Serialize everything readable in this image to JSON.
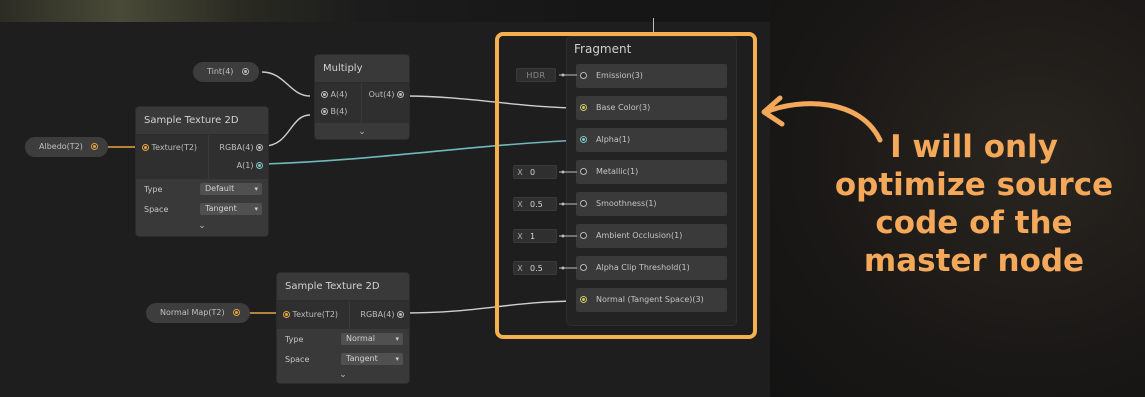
{
  "nodes": {
    "tint": {
      "label": "Tint(4)"
    },
    "albedo": {
      "label": "Albedo(T2)"
    },
    "normal_map": {
      "label": "Normal Map(T2)"
    },
    "multiply": {
      "title": "Multiply",
      "inputs": [
        "A(4)",
        "B(4)"
      ],
      "output": "Out(4)"
    },
    "sample1": {
      "title": "Sample Texture 2D",
      "input": "Texture(T2)",
      "outputs": [
        "RGBA(4)",
        "A(1)"
      ],
      "props": [
        {
          "label": "Type",
          "value": "Default"
        },
        {
          "label": "Space",
          "value": "Tangent"
        }
      ]
    },
    "sample2": {
      "title": "Sample Texture 2D",
      "input": "Texture(T2)",
      "output": "RGBA(4)",
      "props": [
        {
          "label": "Type",
          "value": "Normal"
        },
        {
          "label": "Space",
          "value": "Tangent"
        }
      ]
    }
  },
  "fragment": {
    "title": "Fragment",
    "hdr_label": "HDR",
    "slots": [
      {
        "label": "Emission(3)"
      },
      {
        "label": "Base Color(3)"
      },
      {
        "label": "Alpha(1)"
      },
      {
        "label": "Metallic(1)",
        "axis": "X",
        "value": "0"
      },
      {
        "label": "Smoothness(1)",
        "axis": "X",
        "value": "0.5"
      },
      {
        "label": "Ambient Occlusion(1)",
        "axis": "X",
        "value": "1"
      },
      {
        "label": "Alpha Clip Threshold(1)",
        "axis": "X",
        "value": "0.5"
      },
      {
        "label": "Normal (Tangent Space)(3)"
      }
    ]
  },
  "callout": {
    "text": "I will only optimize source code of the master node"
  },
  "colors": {
    "highlight": "#f4b04e",
    "callout_text": "#f3a85a",
    "wire_texture": "#e6a441",
    "wire_alpha": "#6fb9bb",
    "wire_default": "#cfcfcf"
  }
}
